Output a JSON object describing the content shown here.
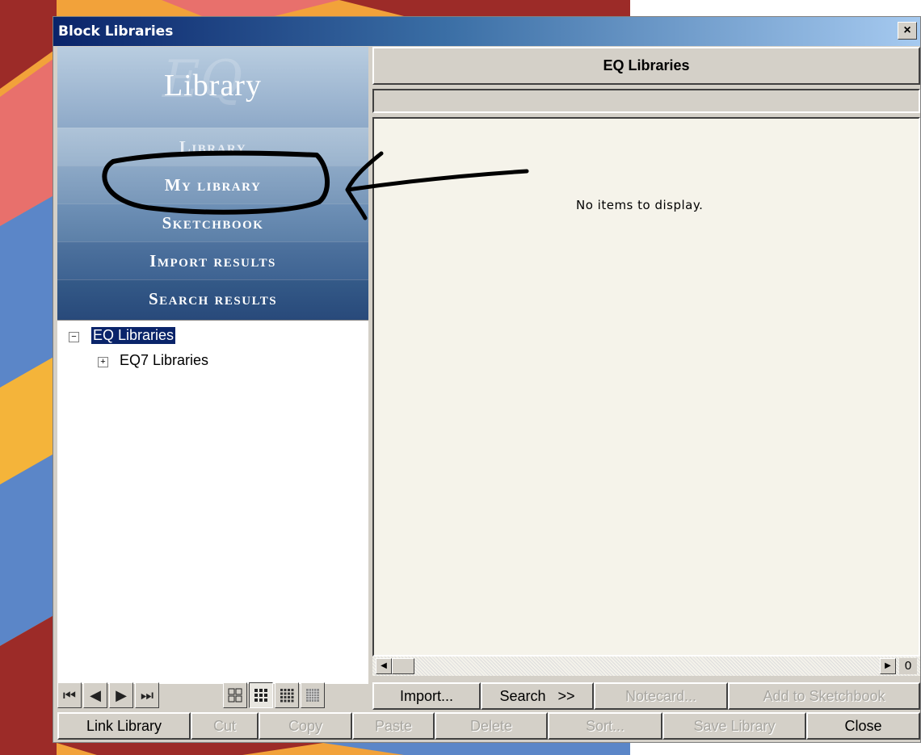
{
  "window": {
    "title": "Block Libraries",
    "close_glyph": "×"
  },
  "library": {
    "watermark": "EQ",
    "header": "Library",
    "nav": [
      {
        "label": "Library"
      },
      {
        "label": "My library"
      },
      {
        "label": "Sketchbook"
      },
      {
        "label": "Import results"
      },
      {
        "label": "Search results"
      }
    ]
  },
  "tree": {
    "root": {
      "label": "EQ Libraries",
      "expander": "−"
    },
    "child": {
      "label": "EQ7 Libraries",
      "expander": "+"
    }
  },
  "panel": {
    "title": "EQ Libraries",
    "empty_message": "No items to display.",
    "page_count": "0"
  },
  "nav_icons": [
    {
      "icon": "first-page-icon",
      "glyph": "⏮"
    },
    {
      "icon": "previous-page-icon",
      "glyph": "◀"
    },
    {
      "icon": "next-page-icon",
      "glyph": "▶"
    },
    {
      "icon": "last-page-icon",
      "glyph": "⏭"
    }
  ],
  "view_icons": [
    {
      "icon": "grid-2x2-icon"
    },
    {
      "icon": "grid-3x3-icon"
    },
    {
      "icon": "grid-4x4-icon"
    },
    {
      "icon": "grid-5x5-icon"
    }
  ],
  "toolbar_row1": [
    {
      "label": "Import...",
      "enabled": true
    },
    {
      "label": "Search   >>",
      "enabled": true
    },
    {
      "label": "Notecard...",
      "enabled": false
    },
    {
      "label": "Add to Sketchbook",
      "enabled": false
    }
  ],
  "toolbar_row2": [
    {
      "label": "Link Library",
      "enabled": true
    },
    {
      "label": "Cut",
      "enabled": false
    },
    {
      "label": "Copy",
      "enabled": false
    },
    {
      "label": "Paste",
      "enabled": false
    },
    {
      "label": "Delete",
      "enabled": false
    },
    {
      "label": "Sort...",
      "enabled": false
    },
    {
      "label": "Save Library",
      "enabled": false
    },
    {
      "label": "Close",
      "enabled": true
    }
  ],
  "colors": {
    "title_gradient_start": "#0a246a",
    "selection": "#0a246a",
    "annotation": "#000000"
  }
}
